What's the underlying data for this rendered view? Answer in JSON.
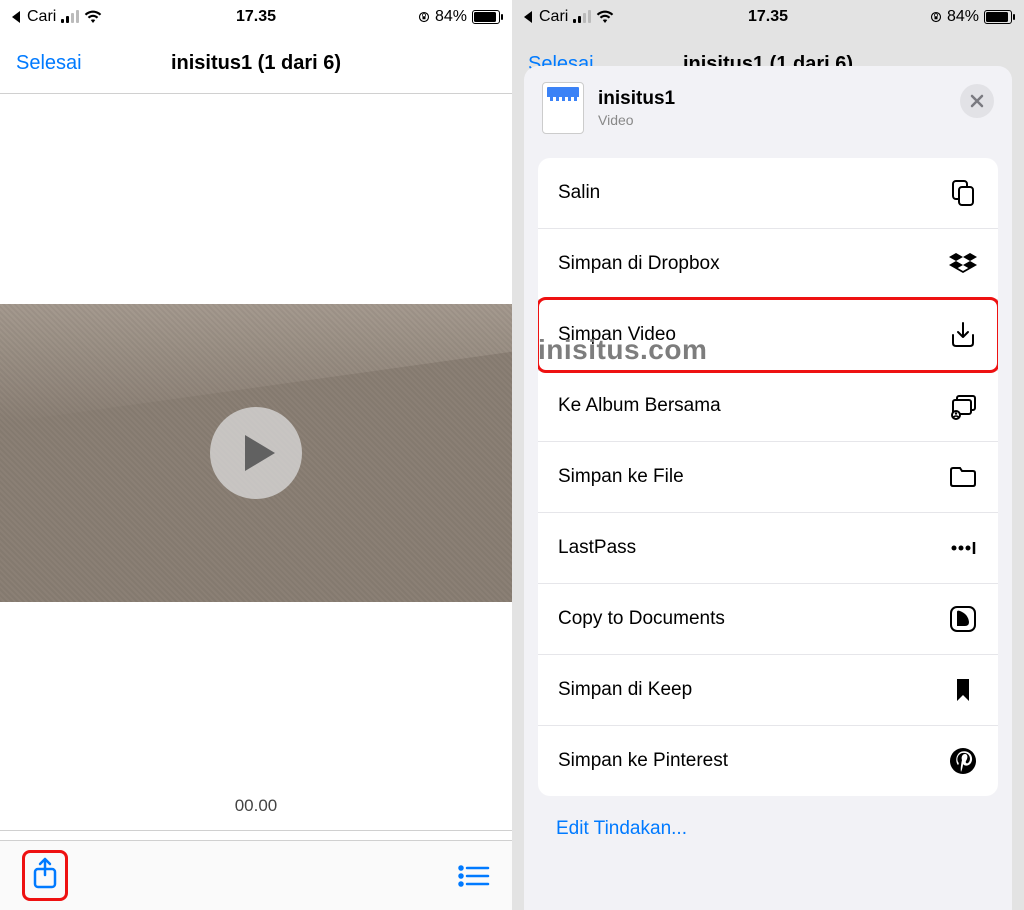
{
  "statusbar": {
    "back_app": "Cari",
    "time": "17.35",
    "battery_pct": "84%"
  },
  "left": {
    "done_label": "Selesai",
    "title": "inisitus1 (1 dari 6)",
    "time_code": "00.00"
  },
  "right": {
    "done_label": "Selesai",
    "title_truncated": "inisitus1 (1 dari 6)",
    "sheet": {
      "file_name": "inisitus1",
      "file_kind": "Video",
      "watermark": "inisitus.com",
      "actions": {
        "copy": "Salin",
        "dropbox": "Simpan di Dropbox",
        "save_video": "Simpan Video",
        "shared_album": "Ke Album Bersama",
        "save_files": "Simpan ke File",
        "lastpass": "LastPass",
        "copy_docs": "Copy to Documents",
        "keep": "Simpan di Keep",
        "pinterest": "Simpan ke Pinterest"
      },
      "edit_actions": "Edit Tindakan..."
    }
  }
}
